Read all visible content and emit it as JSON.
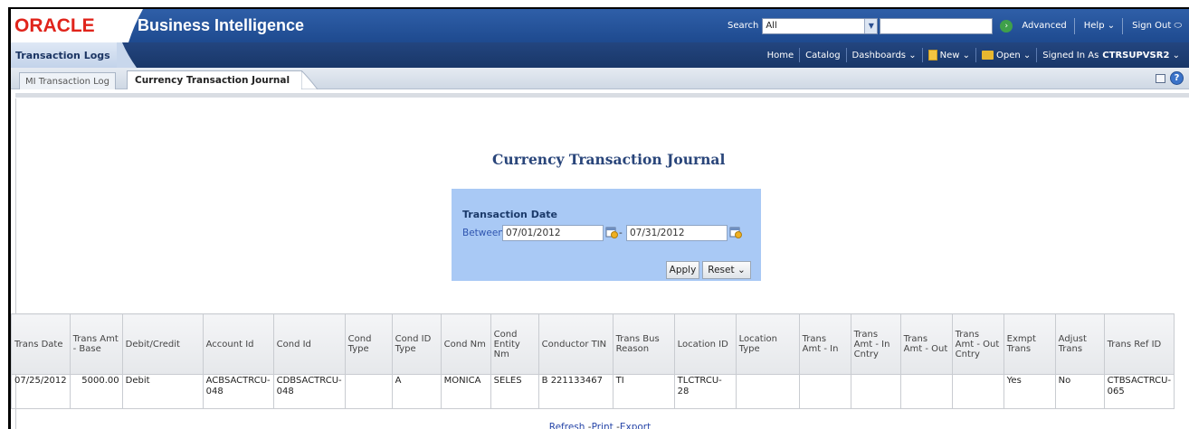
{
  "header": {
    "brand": "ORACLE",
    "title": "Business Intelligence",
    "search_label": "Search",
    "search_scope": "All",
    "search_value": "",
    "advanced": "Advanced",
    "help": "Help",
    "sign_out": "Sign Out"
  },
  "subnav": {
    "section": "Transaction Logs",
    "home": "Home",
    "catalog": "Catalog",
    "dashboards": "Dashboards",
    "new": "New",
    "open": "Open",
    "signed_in_as": "Signed In As",
    "user": "CTRSUPVSR2"
  },
  "tabs": [
    {
      "label": "MI Transaction Log"
    },
    {
      "label": "Currency Transaction Journal"
    }
  ],
  "report": {
    "title": "Currency Transaction Journal",
    "prompt": {
      "label": "Transaction Date",
      "between": "Between",
      "from_date": "07/01/2012",
      "to_date": "07/31/2012",
      "dash": "-",
      "apply": "Apply",
      "reset": "Reset"
    },
    "table": {
      "columns": [
        "Trans Date",
        "Trans Amt - Base",
        "Debit/Credit",
        "Account Id",
        "Cond Id",
        "Cond Type",
        "Cond ID Type",
        "Cond Nm",
        "Cond Entity Nm",
        "Conductor TIN",
        "Trans Bus Reason",
        "Location ID",
        "Location Type",
        "Trans Amt - In",
        "Trans Amt - In Cntry",
        "Trans Amt - Out",
        "Trans Amt - Out Cntry",
        "Exmpt Trans",
        "Adjust Trans",
        "Trans Ref ID"
      ],
      "rows": [
        [
          "07/25/2012",
          "5000.00",
          "Debit",
          "ACBSACTRCU-048",
          "CDBSACTRCU-048",
          "",
          "A",
          "MONICA",
          "SELES",
          "B 221133467",
          "TI",
          "TLCTRCU-28",
          "",
          "",
          "",
          "",
          "",
          "Yes",
          "No",
          "CTBSACTRCU-065"
        ]
      ]
    },
    "footer_links": {
      "refresh": "Refresh",
      "print": "Print",
      "export": "Export",
      "sep": "-"
    }
  },
  "colors": {
    "header_blue": "#1e4a8f",
    "oracle_red": "#e0241b",
    "prompt_bg": "#a9c9f5",
    "title_blue": "#29457a"
  }
}
